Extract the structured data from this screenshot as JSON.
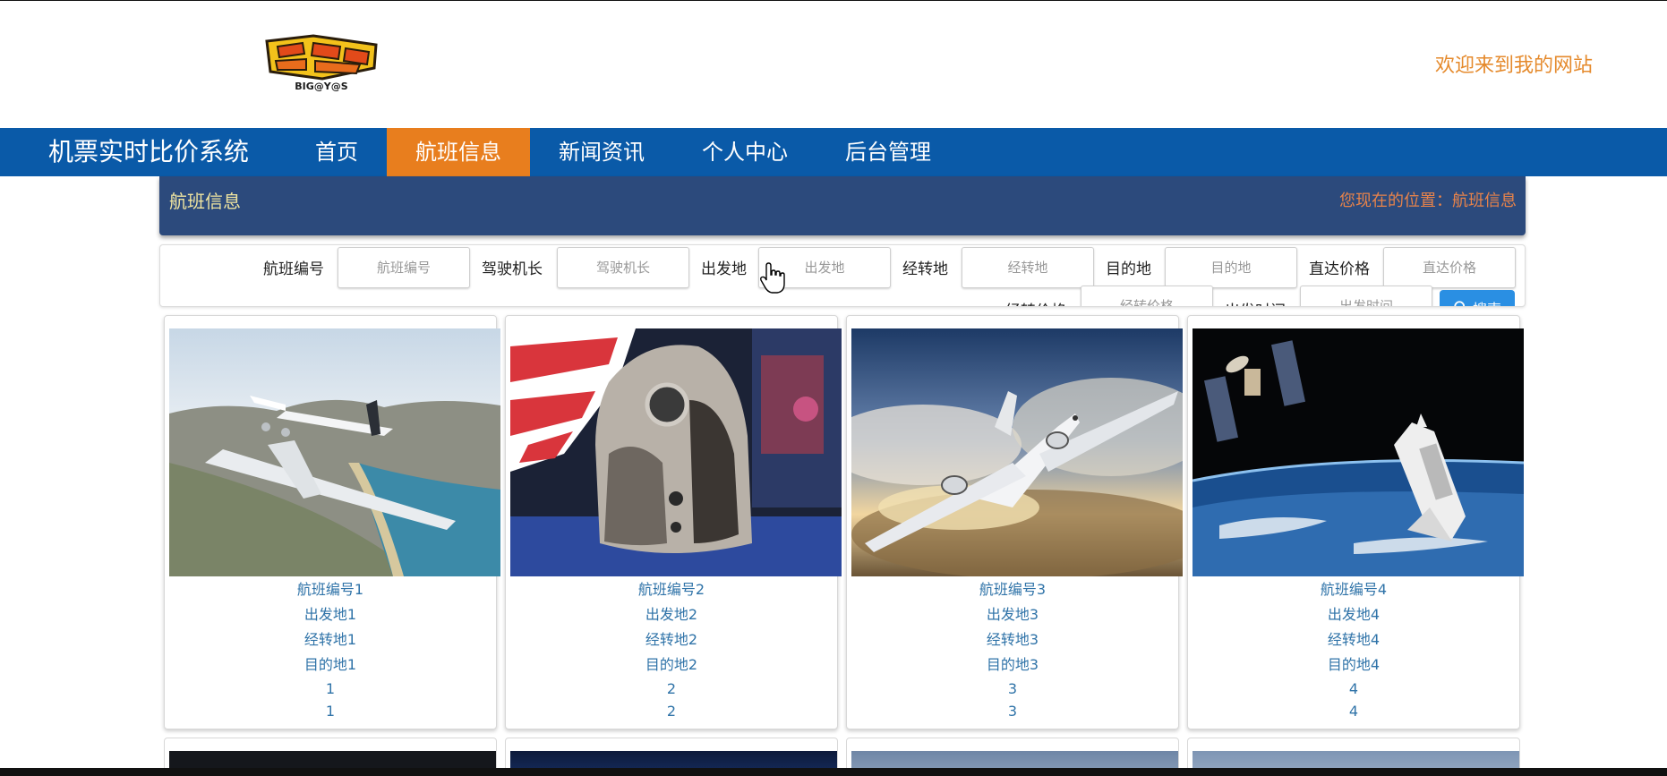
{
  "header": {
    "logo_text": "BIG@Y@S",
    "welcome": "欢迎来到我的网站"
  },
  "nav": {
    "brand": "机票实时比价系统",
    "items": [
      {
        "label": "首页"
      },
      {
        "label": "航班信息"
      },
      {
        "label": "新闻资讯"
      },
      {
        "label": "个人中心"
      },
      {
        "label": "后台管理"
      }
    ]
  },
  "crumb": {
    "title": "航班信息",
    "location": "您现在的位置：航班信息"
  },
  "search": {
    "flight_no_label": "航班编号",
    "flight_no_placeholder": "航班编号",
    "captain_label": "驾驶机长",
    "captain_placeholder": "驾驶机长",
    "depart_label": "出发地",
    "depart_placeholder": "出发地",
    "transfer_label": "经转地",
    "transfer_placeholder": "经转地",
    "dest_label": "目的地",
    "dest_placeholder": "目的地",
    "direct_price_label": "直达价格",
    "direct_price_placeholder": "直达价格",
    "transfer_price_label": "经转价格",
    "transfer_price_placeholder": "经转价格",
    "depart_time_label": "出发时间",
    "depart_time_placeholder": "出发时间",
    "button": "搜索"
  },
  "flights": [
    {
      "no": "航班编号1",
      "from": "出发地1",
      "via": "经转地1",
      "to": "目的地1",
      "direct_price": "1",
      "transfer_price": "1"
    },
    {
      "no": "航班编号2",
      "from": "出发地2",
      "via": "经转地2",
      "to": "目的地2",
      "direct_price": "2",
      "transfer_price": "2"
    },
    {
      "no": "航班编号3",
      "from": "出发地3",
      "via": "经转地3",
      "to": "目的地3",
      "direct_price": "3",
      "transfer_price": "3"
    },
    {
      "no": "航班编号4",
      "from": "出发地4",
      "via": "经转地4",
      "to": "目的地4",
      "direct_price": "4",
      "transfer_price": "4"
    }
  ],
  "colors": {
    "nav_bg": "#0a5aa8",
    "nav_active": "#e87e1e",
    "crumb_bg": "#2c4a7c",
    "welcome": "#e58a2c",
    "card_text": "#2f73a8",
    "search_button": "#2a8fe3"
  }
}
